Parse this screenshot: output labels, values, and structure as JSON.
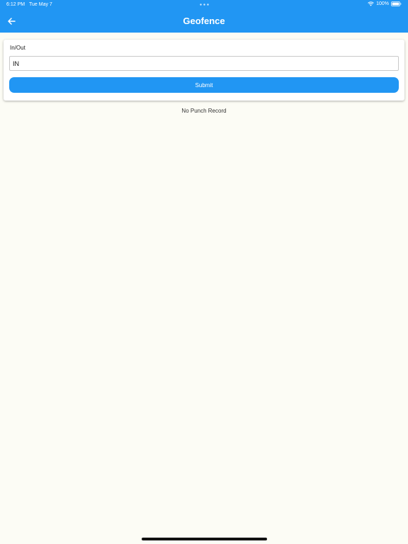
{
  "status_bar": {
    "time": "6:12 PM",
    "date": "Tue May 7",
    "battery": "100%"
  },
  "app_bar": {
    "title": "Geofence",
    "back_icon": "arrow-left-icon"
  },
  "form": {
    "field_label": "In/Out",
    "field_value": "IN",
    "submit_label": "Submit"
  },
  "records": {
    "empty_message": "No Punch Record"
  },
  "colors": {
    "primary": "#2196f3",
    "background": "#fcfcf5"
  }
}
